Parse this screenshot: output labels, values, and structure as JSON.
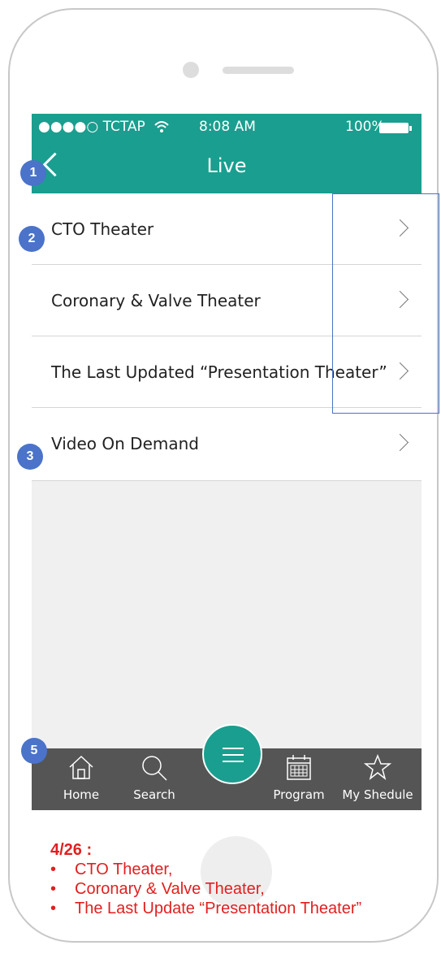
{
  "status_bar": {
    "carrier": "●●●●○ TCTAP",
    "wifi_icon": "wifi-icon",
    "time": "8:08 AM",
    "battery": "100%"
  },
  "nav": {
    "title": "Live",
    "back_icon": "back-chevron-icon"
  },
  "list": {
    "items": [
      {
        "label": "CTO Theater"
      },
      {
        "label": "Coronary & Valve Theater"
      },
      {
        "label": "The Last Updated “Presentation Theater”"
      },
      {
        "label": "Video On Demand"
      }
    ]
  },
  "tab_bar": {
    "tabs": [
      {
        "label": "Home",
        "icon": "home-icon"
      },
      {
        "label": "Search",
        "icon": "search-icon"
      },
      {
        "label": "Program",
        "icon": "calendar-icon"
      },
      {
        "label": "My Shedule",
        "icon": "star-icon"
      }
    ],
    "menu_icon": "hamburger-menu-icon"
  },
  "annotations": {
    "badges": [
      "1",
      "2",
      "3",
      "5"
    ]
  },
  "note": {
    "title": "4/26 :",
    "bullet": "•",
    "items": [
      "CTO Theater,",
      "Coronary & Valve Theater,",
      "The Last Update “Presentation Theater”"
    ]
  },
  "colors": {
    "accent": "#1a9e8f",
    "tab_bar": "#555555",
    "annotation": "#4a73c9",
    "note_text": "#e02020"
  }
}
